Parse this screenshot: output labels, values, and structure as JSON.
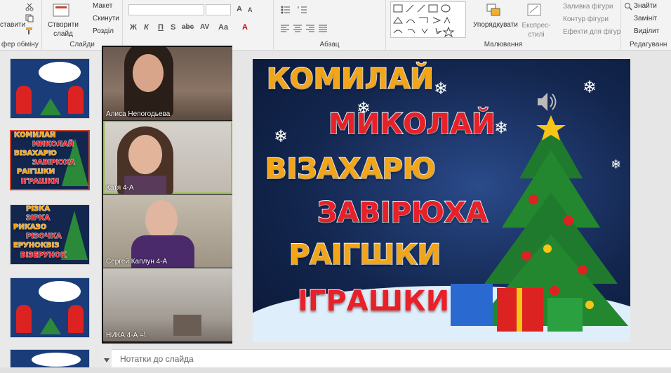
{
  "ribbon": {
    "clipboard": {
      "paste_label": "ставити",
      "group_label": "фер обміну"
    },
    "slides": {
      "new_slide_label": "Створити слайд",
      "layout_label": "Макет",
      "reset_label": "Скинути",
      "section_label": "Розділ",
      "group_label": "Слайди"
    },
    "font": {
      "bold": "Ж",
      "italic": "К",
      "underline": "П",
      "strike": "S",
      "spacing": "abc",
      "case": "AV",
      "aa": "Aa",
      "size_up": "A",
      "size_down": "A"
    },
    "paragraph": {
      "group_label": "Абзац"
    },
    "drawing": {
      "group_label": "Малювання",
      "arrange_label": "Упорядкувати",
      "styles_label": "Експрес-стилі",
      "fill_label": "Заливка фігури",
      "outline_label": "Контур фігури",
      "effects_label": "Ефекти для фігур"
    },
    "editing": {
      "group_label": "Редагуванн",
      "find_label": "Знайти",
      "replace_label": "Замініт",
      "select_label": "Виділит"
    }
  },
  "thumbnails": [
    {
      "num": "",
      "words": []
    },
    {
      "num": "",
      "words": [
        "КОМИЛАЙ",
        "МИКОЛАЙ",
        "ВІЗАХАРЮ",
        "ЗАВІРЮХА",
        "РАІГШКИ",
        "ІГРАШКИ"
      ]
    },
    {
      "num": "",
      "words": [
        "РІЗКА",
        "ЗІРКА",
        "РИКАЗО",
        "РІЗОЧКА",
        "ЕРУНОКВІЗ",
        "ВІЗЕРУНОК"
      ]
    },
    {
      "num": "",
      "words": []
    }
  ],
  "videos": [
    {
      "name": "Алиса Непогодьева"
    },
    {
      "name": "Катя 4-А"
    },
    {
      "name": "Сергей Каплун 4-А"
    },
    {
      "name": "НИКА 4-А =\\"
    }
  ],
  "slide": {
    "words": [
      {
        "text": "КОМИЛАЙ",
        "color": "#f2a516"
      },
      {
        "text": "МИКОЛАЙ",
        "color": "#e8202a"
      },
      {
        "text": "ВІЗАХАРЮ",
        "color": "#f2a516"
      },
      {
        "text": "ЗАВІРЮХА",
        "color": "#e8202a"
      },
      {
        "text": "РАІГШКИ",
        "color": "#f2a516"
      },
      {
        "text": "ІГРАШКИ",
        "color": "#e8202a"
      }
    ]
  },
  "notes": {
    "placeholder": "Нотатки до слайда"
  }
}
